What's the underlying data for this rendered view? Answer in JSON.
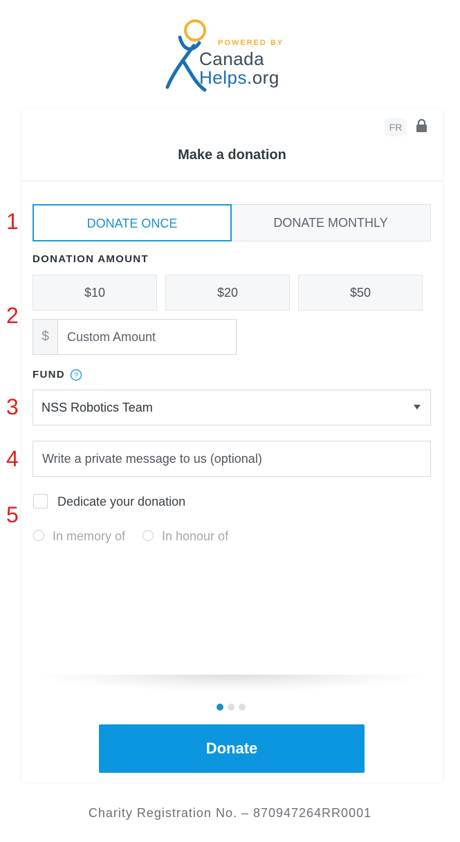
{
  "brand": {
    "powered_by": "POWERED BY",
    "name_line1": "Canada",
    "name_line2": "Helps",
    "name_suffix": ".org",
    "colors": {
      "yellow": "#f2b233",
      "blue": "#1c6fb0",
      "dark": "#3d4a5a"
    }
  },
  "header": {
    "language_toggle": "FR",
    "title": "Make a donation",
    "lock_icon": "lock-icon"
  },
  "frequency_tabs": {
    "once_label": "DONATE ONCE",
    "monthly_label": "DONATE MONTHLY",
    "selected": "once"
  },
  "amount": {
    "section_label": "DONATION AMOUNT",
    "presets": [
      "$10",
      "$20",
      "$50"
    ],
    "currency_symbol": "$",
    "custom_placeholder": "Custom Amount"
  },
  "fund": {
    "section_label": "FUND",
    "help_icon": "question-circle-icon",
    "selected_value": "NSS Robotics Team"
  },
  "message": {
    "placeholder": "Write a private message to us (optional)"
  },
  "dedication": {
    "checkbox_label": "Dedicate your donation",
    "checked": false,
    "options": [
      "In memory of",
      "In honour of"
    ]
  },
  "pagination": {
    "total_steps": 3,
    "current_step": 1
  },
  "donate_button_label": "Donate",
  "footer": {
    "registration": "Charity Registration No.  –  870947264RR0001"
  },
  "step_markers": [
    "1",
    "2",
    "3",
    "4",
    "5"
  ],
  "accent_color": "#0c96df"
}
